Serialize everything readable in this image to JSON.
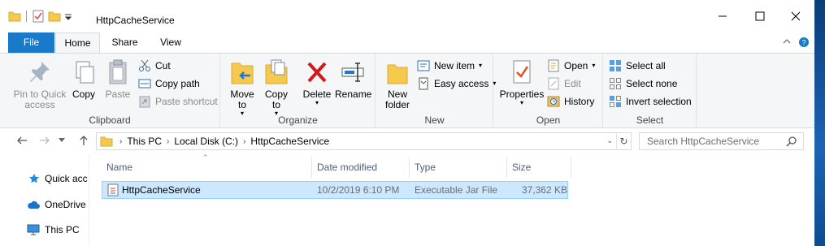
{
  "window": {
    "title": "HttpCacheService",
    "controls": [
      "minimize",
      "maximize",
      "close"
    ]
  },
  "ribbon_tabs": {
    "file": "File",
    "home": "Home",
    "share": "Share",
    "view": "View"
  },
  "clipboard": {
    "label": "Clipboard",
    "pin": "Pin to Quick access",
    "copy": "Copy",
    "paste": "Paste",
    "cut": "Cut",
    "copy_path": "Copy path",
    "paste_shortcut": "Paste shortcut"
  },
  "organize": {
    "label": "Organize",
    "move_to": "Move to",
    "copy_to": "Copy to",
    "delete": "Delete",
    "rename": "Rename"
  },
  "new_group": {
    "label": "New",
    "new_folder": "New folder",
    "new_item": "New item",
    "easy_access": "Easy access"
  },
  "open_group": {
    "label": "Open",
    "properties": "Properties",
    "open": "Open",
    "edit": "Edit",
    "history": "History"
  },
  "select_group": {
    "label": "Select",
    "select_all": "Select all",
    "select_none": "Select none",
    "invert_selection": "Invert selection"
  },
  "address": {
    "crumbs": [
      "This PC",
      "Local Disk (C:)",
      "HttpCacheService"
    ],
    "search_placeholder": "Search HttpCacheService"
  },
  "navpane": {
    "items": [
      "Quick acc",
      "OneDrive",
      "This PC"
    ]
  },
  "columns": {
    "name": "Name",
    "date_modified": "Date modified",
    "type": "Type",
    "size": "Size"
  },
  "files": [
    {
      "name": "HttpCacheService",
      "date_modified": "10/2/2019 6:10 PM",
      "type": "Executable Jar File",
      "size": "37,362 KB"
    }
  ],
  "colors": {
    "file_tab": "#1979ca",
    "selection": "#cce8ff",
    "delete_red": "#d11a1a",
    "folder_yellow": "#f5c94c"
  }
}
